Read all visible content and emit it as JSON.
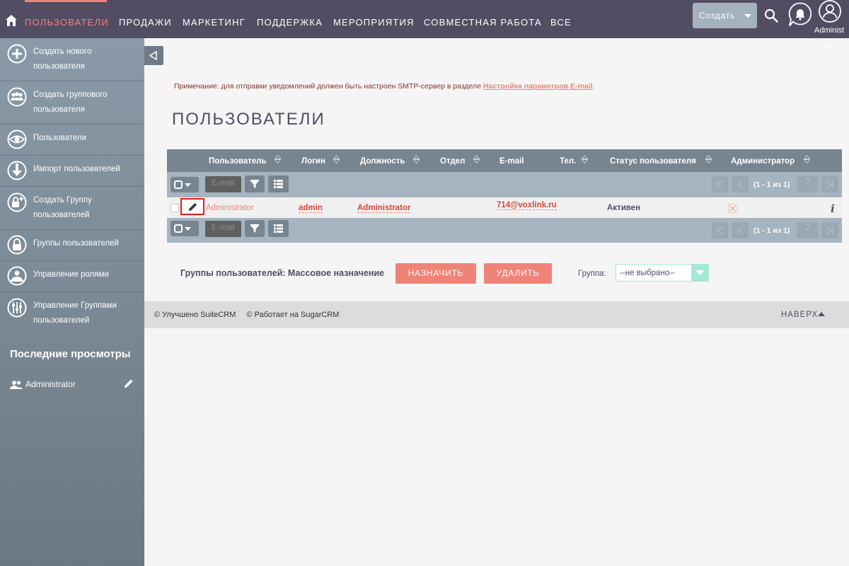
{
  "nav": {
    "items": [
      "ПОЛЬЗОВАТЕЛИ",
      "ПРОДАЖИ",
      "МАРКЕТИНГ",
      "ПОДДЕРЖКА",
      "МЕРОПРИЯТИЯ",
      "СОВМЕСТНАЯ РАБОТА",
      "ВСЕ"
    ],
    "create_label": "Создать",
    "user_name": "Administ",
    "accent_color": "#f08377"
  },
  "sidebar": {
    "items": [
      {
        "label": "Создать нового пользователя",
        "icon": "plus-circle-icon"
      },
      {
        "label": "Создать группового пользователя",
        "icon": "group-users-icon"
      },
      {
        "label": "Пользователи",
        "icon": "eye-icon"
      },
      {
        "label": "Импорт пользователей",
        "icon": "import-arrow-icon"
      },
      {
        "label": "Создать Группу пользователей",
        "icon": "lock-plus-icon"
      },
      {
        "label": "Группы пользователей",
        "icon": "lock-icon"
      },
      {
        "label": "Управление ролями",
        "icon": "roles-icon"
      },
      {
        "label": "Управление Группами пользователей",
        "icon": "sliders-icon"
      }
    ],
    "recent_title": "Последние просмотры",
    "recent_items": [
      {
        "label": "Administrator"
      }
    ]
  },
  "main": {
    "note_text": "Примечание: для отправки уведомлений должен быть настроен SMTP-сервер в разделе ",
    "note_link": "Настройка параметров E-mail",
    "note_end": ".",
    "title": "ПОЛЬЗОВАТЕЛИ",
    "columns": [
      "Пользователь",
      "Логин",
      "Должность",
      "Отдел",
      "E-mail",
      "Тел.",
      "Статус пользователя",
      "Администратор"
    ],
    "toolbar": {
      "email_label": "E-mail",
      "pagination": "(1 - 1 из 1)"
    },
    "rows": [
      {
        "user": "Administrator",
        "login": "admin",
        "title": "Administrator",
        "department": "",
        "email": "714@voxlink.ru",
        "phone": "",
        "status": "Активен",
        "is_admin": false
      }
    ],
    "mass_assign_label": "Группы пользователей: Массовое назначение",
    "assign_button": "НАЗНАЧИТЬ",
    "delete_button": "УДАЛИТЬ",
    "group_label": "Группа:",
    "group_value": "--не выбрано--"
  },
  "footer": {
    "suitecrm": "© Улучшено SuiteCRM",
    "sugarcrm": "© Работает на SugarCRM",
    "top_label": "НАВЕРХ"
  }
}
